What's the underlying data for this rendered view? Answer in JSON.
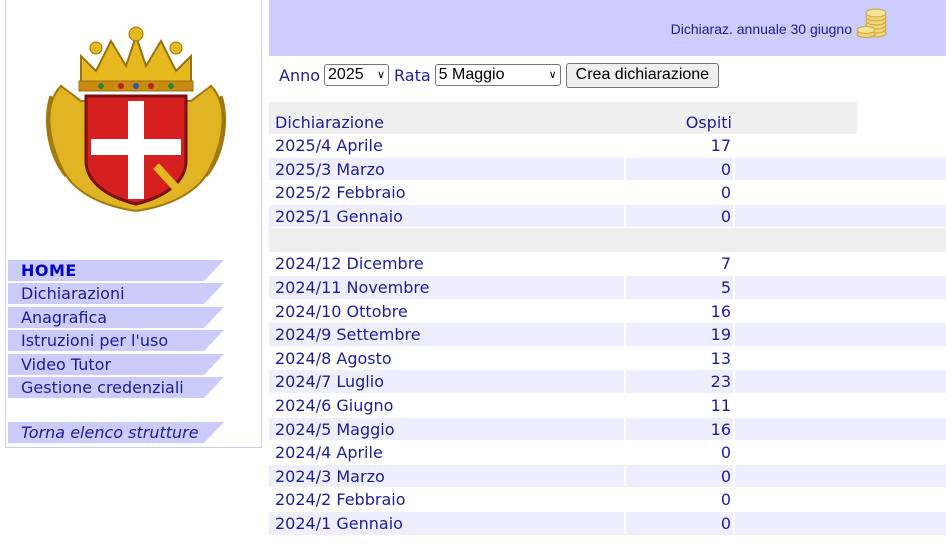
{
  "sidebar": {
    "logo_icon": "coat-of-arms-icon",
    "menu": [
      {
        "label": "HOME",
        "name": "menu-item-home"
      },
      {
        "label": "Dichiarazioni",
        "name": "menu-item-dichiarazioni"
      },
      {
        "label": "Anagrafica",
        "name": "menu-item-anagrafica"
      },
      {
        "label": "Istruzioni per l'uso",
        "name": "menu-item-istruzioni"
      },
      {
        "label": "Video Tutor",
        "name": "menu-item-video-tutor"
      },
      {
        "label": "Gestione credenziali",
        "name": "menu-item-gestione-credenziali"
      }
    ],
    "back_label": "Torna elenco strutture"
  },
  "topbar": {
    "notice": "Dichiaraz. annuale 30 giugno",
    "notice_icon": "coins-icon"
  },
  "controls": {
    "anno_label": "Anno",
    "anno_value": "2025",
    "rata_label": "Rata",
    "rata_value": "5 Maggio",
    "create_button": "Crea dichiarazione"
  },
  "table": {
    "col_dichiarazione": "Dichiarazione",
    "col_ospiti": "Ospiti",
    "group_2025": [
      {
        "label": "2025/4 Aprile",
        "ospiti": "17"
      },
      {
        "label": "2025/3 Marzo",
        "ospiti": "0"
      },
      {
        "label": "2025/2 Febbraio",
        "ospiti": "0"
      },
      {
        "label": "2025/1 Gennaio",
        "ospiti": "0"
      }
    ],
    "group_2024": [
      {
        "label": "2024/12 Dicembre",
        "ospiti": "7"
      },
      {
        "label": "2024/11 Novembre",
        "ospiti": "5"
      },
      {
        "label": "2024/10 Ottobre",
        "ospiti": "16"
      },
      {
        "label": "2024/9 Settembre",
        "ospiti": "19"
      },
      {
        "label": "2024/8 Agosto",
        "ospiti": "13"
      },
      {
        "label": "2024/7 Luglio",
        "ospiti": "23"
      },
      {
        "label": "2024/6 Giugno",
        "ospiti": "11"
      },
      {
        "label": "2024/5 Maggio",
        "ospiti": "16"
      },
      {
        "label": "2024/4 Aprile",
        "ospiti": "0"
      },
      {
        "label": "2024/3 Marzo",
        "ospiti": "0"
      },
      {
        "label": "2024/2 Febbraio",
        "ospiti": "0"
      },
      {
        "label": "2024/1 Gennaio",
        "ospiti": "0"
      }
    ]
  },
  "colors": {
    "header_bg": "#ccccff",
    "menu_bg": "#ccccfa",
    "link_text": "#1c1c9c",
    "row_alt": "#eeeeff"
  }
}
